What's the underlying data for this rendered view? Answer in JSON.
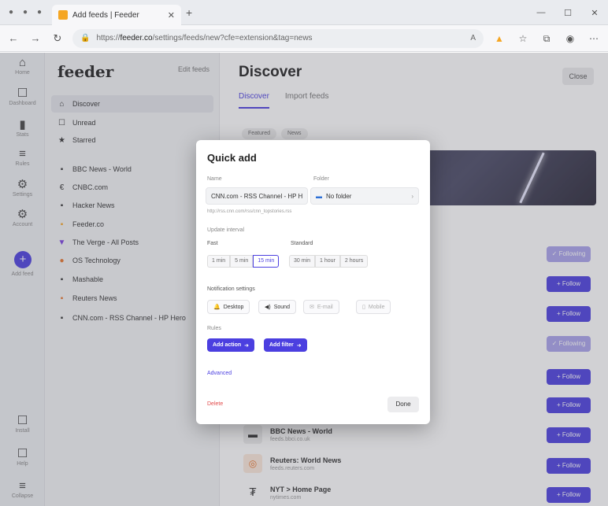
{
  "browser": {
    "tab_title": "Add feeds | Feeder",
    "url_prefix": "https://",
    "url_host": "feeder.co",
    "url_path": "/settings/feeds/new?cfe=extension&tag=news"
  },
  "rail": {
    "items": [
      {
        "icon": "⌂",
        "label": "Home"
      },
      {
        "icon": "☐",
        "label": "Dashboard"
      },
      {
        "icon": "▮",
        "label": "Stats"
      },
      {
        "icon": "≡",
        "label": "Rules"
      },
      {
        "icon": "⚙",
        "label": "Settings"
      },
      {
        "icon": "⚙",
        "label": "Account"
      }
    ],
    "add_label": "Add feed",
    "bottom": [
      {
        "icon": "☐",
        "label": "Install"
      },
      {
        "icon": "☐",
        "label": "Help"
      },
      {
        "icon": "≡",
        "label": "Collapse"
      }
    ]
  },
  "sidebar": {
    "brand": "feeder",
    "edit": "Edit feeds",
    "items": [
      {
        "icon": "⌂",
        "label": "Discover"
      },
      {
        "icon": "☐",
        "label": "Unread"
      },
      {
        "icon": "★",
        "label": "Starred"
      },
      {
        "icon": "▪",
        "label": "BBC News - World"
      },
      {
        "icon": "€",
        "label": "CNBC.com"
      },
      {
        "icon": "▪",
        "label": "Hacker News"
      },
      {
        "icon": "▪",
        "label": "Feeder.co"
      },
      {
        "icon": "▼",
        "label": "The Verge - All Posts"
      },
      {
        "icon": "●",
        "label": "OS Technology"
      },
      {
        "icon": "▪",
        "label": "Mashable"
      },
      {
        "icon": "▪",
        "label": "Reuters News"
      },
      {
        "icon": "▪",
        "label": "CNN.com - RSS Channel - HP Hero"
      }
    ]
  },
  "main": {
    "title": "Discover",
    "tab_discover": "Discover",
    "tab_import": "Import feeds",
    "close": "Close",
    "filters": [
      "Featured",
      "News"
    ],
    "follow": "+ Follow",
    "following": "✓ Following",
    "feeds": [
      {
        "icon": "▬",
        "name": "BBC News - World",
        "sub": "feeds.bbci.co.uk"
      },
      {
        "icon": "◎",
        "name": "Reuters: World News",
        "sub": "feeds.reuters.com"
      },
      {
        "icon": "₮",
        "name": "NYT > Home Page",
        "sub": "nytimes.com"
      }
    ]
  },
  "modal": {
    "title": "Quick add",
    "name_label": "Name",
    "name_value": "CNN.com - RSS Channel - HP Hero",
    "folder_label": "Folder",
    "folder_value": "No folder",
    "feed_url": "http://rss.cnn.com/rss/cnn_topstories.rss",
    "update_label": "Update interval",
    "fast_label": "Fast",
    "standard_label": "Standard",
    "fast_options": [
      "1 min",
      "5 min",
      "15 min"
    ],
    "standard_options": [
      "30 min",
      "1 hour",
      "2 hours"
    ],
    "notif_label": "Notification settings",
    "notif": [
      "Desktop",
      "Sound",
      "E-mail",
      "Mobile"
    ],
    "rules_label": "Rules",
    "add_action": "Add action",
    "add_filter": "Add filter",
    "advanced": "Advanced",
    "delete": "Delete",
    "done": "Done"
  }
}
